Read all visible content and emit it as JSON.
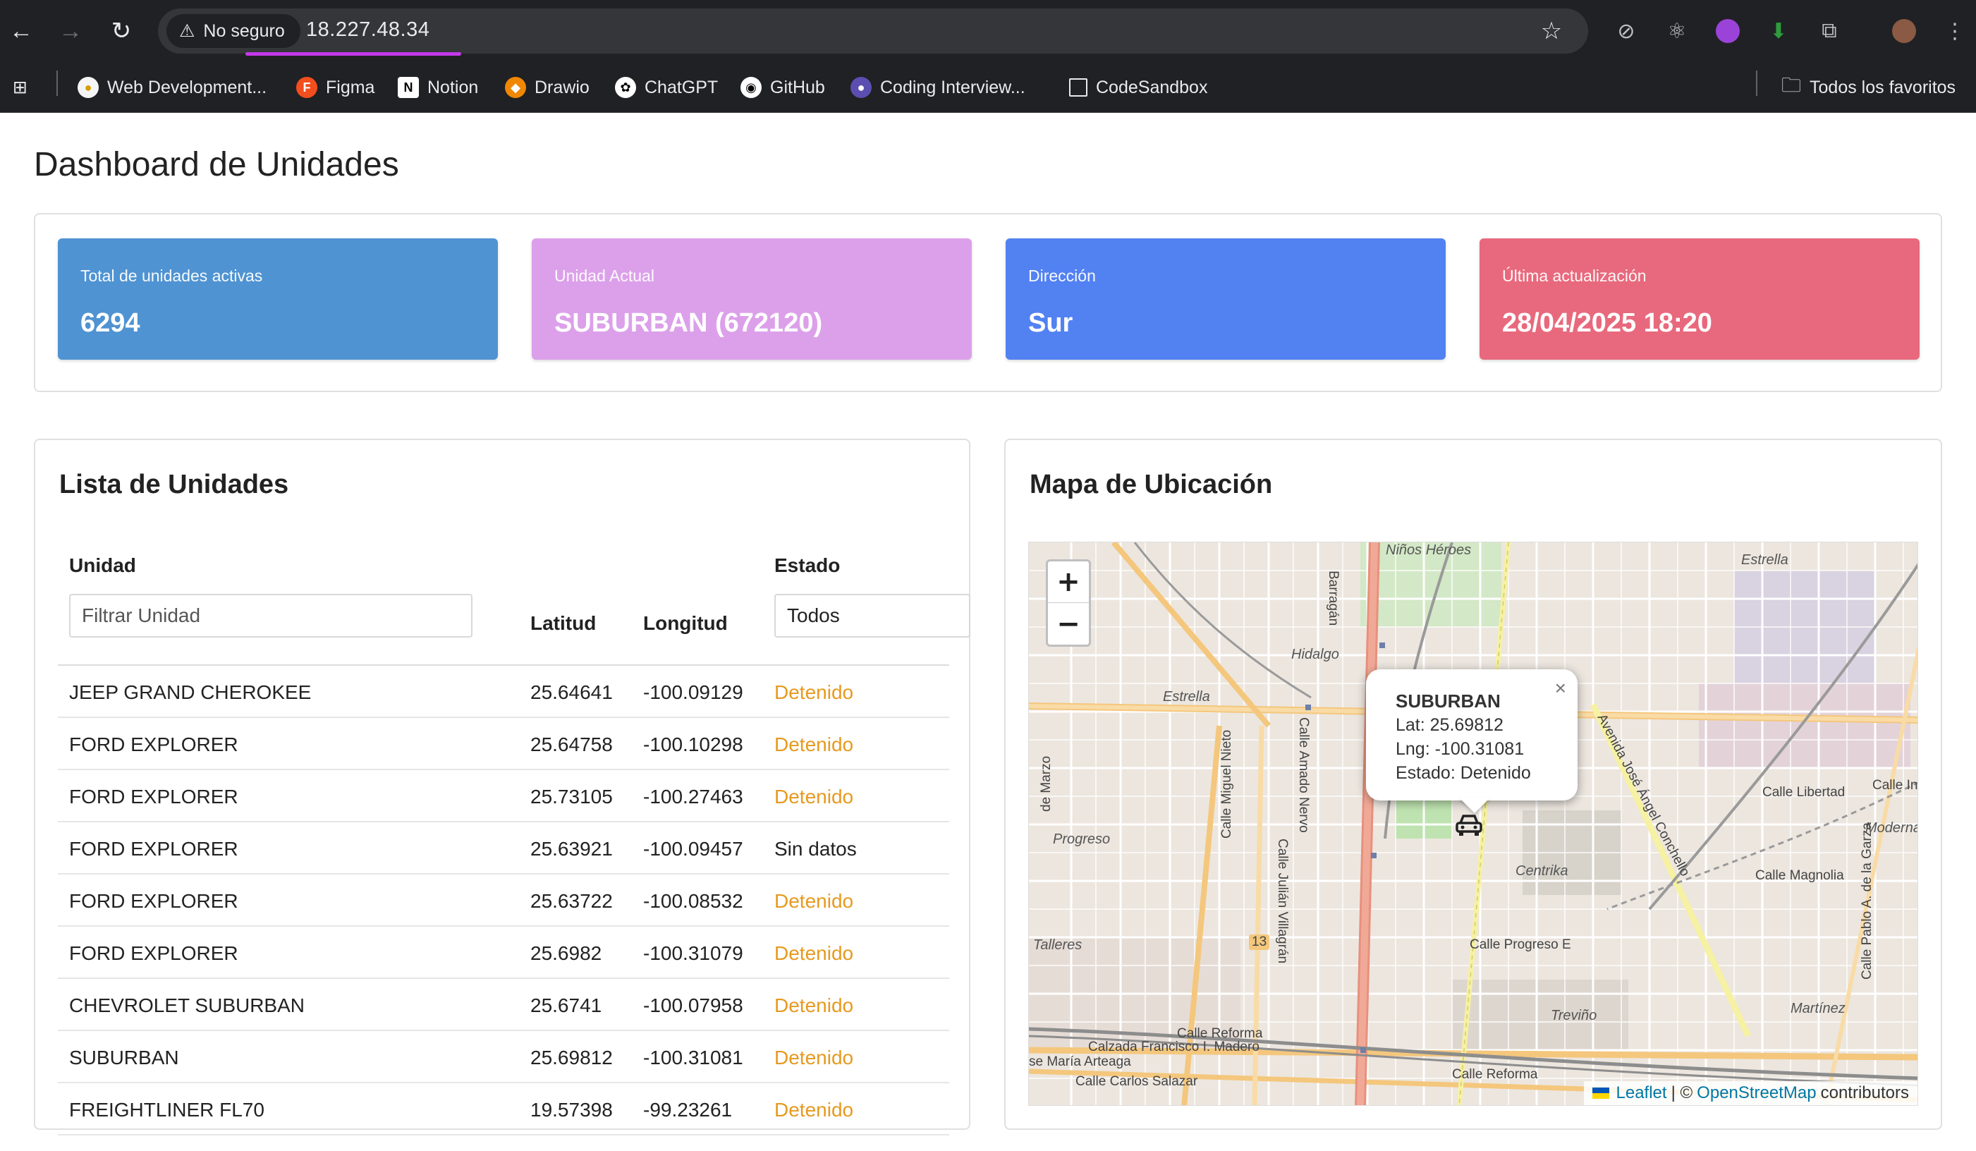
{
  "browser": {
    "security_label": "No seguro",
    "url": "18.227.48.34",
    "bookmarks": [
      {
        "label": "Web Development...",
        "icon": "web-dev-icon"
      },
      {
        "label": "Figma",
        "icon": "figma-icon"
      },
      {
        "label": "Notion",
        "icon": "notion-icon"
      },
      {
        "label": "Drawio",
        "icon": "drawio-icon"
      },
      {
        "label": "ChatGPT",
        "icon": "chatgpt-icon"
      },
      {
        "label": "GitHub",
        "icon": "github-icon"
      },
      {
        "label": "Coding Interview...",
        "icon": "coding-interview-icon"
      },
      {
        "label": "CodeSandbox",
        "icon": "codesandbox-icon"
      }
    ],
    "all_bookmarks_label": "Todos los favoritos"
  },
  "page": {
    "title": "Dashboard de Unidades"
  },
  "stats": {
    "total": {
      "label": "Total de unidades activas",
      "value": "6294",
      "color": "#4f93d2"
    },
    "current": {
      "label": "Unidad Actual",
      "value": "SUBURBAN (672120)",
      "color": "#dca0ea"
    },
    "direction": {
      "label": "Dirección",
      "value": "Sur",
      "color": "#5281f2"
    },
    "updated": {
      "label": "Última actualización",
      "value": "28/04/2025 18:20",
      "color": "#e8697d"
    }
  },
  "list": {
    "title": "Lista de Unidades",
    "columns": {
      "unit": "Unidad",
      "lat": "Latitud",
      "lng": "Longitud",
      "status": "Estado"
    },
    "filter_placeholder": "Filtrar Unidad",
    "status_filter_value": "Todos",
    "rows": [
      {
        "unit": "JEEP GRAND CHEROKEE",
        "lat": "25.64641",
        "lng": "-100.09129",
        "status": "Detenido"
      },
      {
        "unit": "FORD EXPLORER",
        "lat": "25.64758",
        "lng": "-100.10298",
        "status": "Detenido"
      },
      {
        "unit": "FORD EXPLORER",
        "lat": "25.73105",
        "lng": "-100.27463",
        "status": "Detenido"
      },
      {
        "unit": "FORD EXPLORER",
        "lat": "25.63921",
        "lng": "-100.09457",
        "status": "Sin datos"
      },
      {
        "unit": "FORD EXPLORER",
        "lat": "25.63722",
        "lng": "-100.08532",
        "status": "Detenido"
      },
      {
        "unit": "FORD EXPLORER",
        "lat": "25.6982",
        "lng": "-100.31079",
        "status": "Detenido"
      },
      {
        "unit": "CHEVROLET SUBURBAN",
        "lat": "25.6741",
        "lng": "-100.07958",
        "status": "Detenido"
      },
      {
        "unit": "SUBURBAN",
        "lat": "25.69812",
        "lng": "-100.31081",
        "status": "Detenido"
      },
      {
        "unit": "FREIGHTLINER FL70",
        "lat": "19.57398",
        "lng": "-99.23261",
        "status": "Detenido"
      }
    ]
  },
  "map": {
    "title": "Mapa de Ubicación",
    "zoom_in": "+",
    "zoom_out": "−",
    "popup": {
      "title": "SUBURBAN",
      "lat": "Lat: 25.69812",
      "lng": "Lng: -100.31081",
      "status": "Estado: Detenido",
      "close": "×"
    },
    "attribution": {
      "leaflet": "Leaflet",
      "sep": "| ©",
      "osm": "OpenStreetMap",
      "suffix": "contributors"
    },
    "labels": {
      "ninos_heroes": "Niños Héroes",
      "estrella_top": "Estrella",
      "hidalgo": "Hidalgo",
      "estrella": "Estrella",
      "barragan": "Barragán",
      "amado_nervo": "Calle Amado Nervo",
      "progreso": "Progreso",
      "centrika": "Centrika",
      "miguel_nieto": "Calle Miguel Nieto",
      "julian_villagran": "Calle Julián Villagrán",
      "progreso_e": "Calle Progreso E",
      "talleres": "Talleres",
      "route_13": "13",
      "reforma_1": "Calle Reforma",
      "madero": "Calzada Francisco I. Madero",
      "arteaga": "se María Arteaga",
      "salazar": "Calle Carlos Salazar",
      "reforma_2": "Calle Reforma",
      "treviño": "Treviño",
      "libertad": "Calle Libertad",
      "magnolia": "Calle Magnolia",
      "moderna": "Moderna",
      "martinez": "Martínez",
      "concheiro": "Avenida José Ángel Conchello",
      "pablo_garza": "Calle Pablo A. de la Garza",
      "independencia": "Calle Indep",
      "marzo": "de Marzo"
    }
  }
}
